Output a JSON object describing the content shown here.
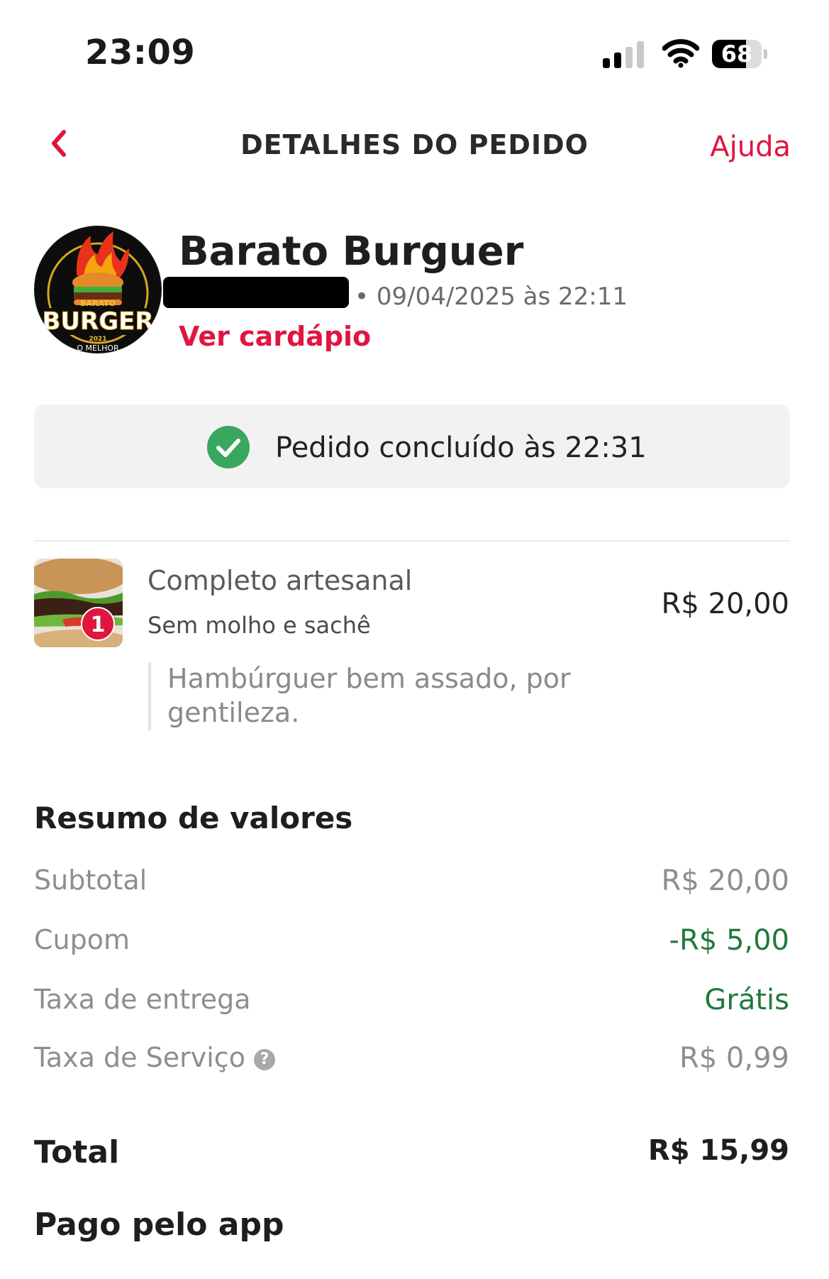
{
  "status_bar": {
    "time": "23:09",
    "battery": "68",
    "battery_level": 0.68
  },
  "header": {
    "title": "DETALHES DO PEDIDO",
    "help_label": "Ajuda"
  },
  "restaurant": {
    "name": "Barato Burguer",
    "order_date": "• 09/04/2025 às 22:11",
    "menu_link": "Ver cardápio",
    "logo": {
      "top_text": "BARATO",
      "main_text": "BURGER",
      "year": "2021",
      "bottom_text": "O MELHOR"
    }
  },
  "order_status": {
    "text": "Pedido concluído às 22:31"
  },
  "item": {
    "quantity": "1",
    "name": "Completo artesanal",
    "description": "Sem molho e sachê",
    "price": "R$ 20,00",
    "note": "Hambúrguer bem assado, por gentileza."
  },
  "summary": {
    "title": "Resumo de valores",
    "rows": [
      {
        "label": "Subtotal",
        "value": "R$ 20,00"
      },
      {
        "label": "Cupom",
        "value": "-R$ 5,00"
      },
      {
        "label": "Taxa de entrega",
        "value": "Grátis"
      },
      {
        "label": "Taxa de Serviço",
        "value": "R$ 0,99"
      }
    ],
    "total_label": "Total",
    "total_value": "R$ 15,99",
    "paid_label": "Pago pelo app"
  },
  "colors": {
    "accent": "#e0163f",
    "success": "#1f7a3a",
    "check_green": "#3aa760"
  }
}
